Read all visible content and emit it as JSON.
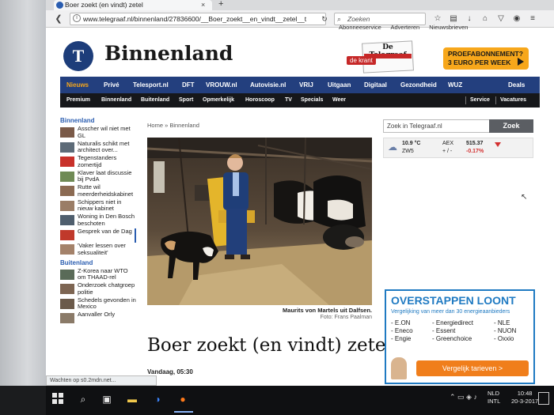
{
  "browser": {
    "tab_title": "Boer zoekt (en vindt) zetel",
    "tab_close": "×",
    "new_tab": "+",
    "url": "www.telegraaf.nl/binnenland/27836600/__Boer_zoekt__en_vindt__zetel__t",
    "search_placeholder": "Zoeken",
    "status_text": "Wachten op s0.2mdn.net..."
  },
  "header": {
    "top_links": [
      "Abonneeservice",
      "Adverteren",
      "Nieuwsbrieven"
    ],
    "logo_letter": "T",
    "section_title": "Binnenland",
    "paper_masthead": "De Telegraaf",
    "paper_label": "de krant",
    "promo_line1": "PROEFABONNEMENT?",
    "promo_line2": "3 EURO PER WEEK"
  },
  "main_nav": [
    "Nieuws",
    "Privé",
    "Telesport.nl",
    "DFT",
    "VROUW.nl",
    "Autovisie.nl",
    "VRIJ",
    "Uitgaan",
    "Digitaal",
    "Gezondheid",
    "WUZ",
    "Deals"
  ],
  "sub_nav": [
    "Premium",
    "Binnenland",
    "Buitenland",
    "Sport",
    "Opmerkelijk",
    "Horoscoop",
    "TV",
    "Specials",
    "Weer"
  ],
  "sub_nav_right": [
    "Service",
    "Vacatures"
  ],
  "sidebar": {
    "section1": "Binnenland",
    "items1": [
      "Asscher wil niet met GL",
      "Naturalis schikt met architect over...",
      "Tegenstanders zomertijd",
      "Klaver laat discussie bij PvdA",
      "Rutte wil meerderheidskabinet",
      "Schippers niet in nieuw kabinet",
      "Woning in Den Bosch beschoten",
      "Gesprek van de Dag",
      "'Vaker lessen over seksualiteit'"
    ],
    "section2": "Buitenland",
    "items2": [
      "Z-Korea naar WTO om THAAD-rel",
      "Onderzoek chatgroep politie",
      "Schedels gevonden in Mexico",
      "Aanvaller Orly"
    ]
  },
  "article": {
    "breadcrumb": "Home » Binnenland",
    "caption": "Maurits von Martels uit Dalfsen.",
    "credit": "Foto: Frans Paalman",
    "headline": "Boer zoekt (en vindt) zetel",
    "dateline": "Vandaag, 05:30"
  },
  "right": {
    "search_placeholder": "Zoek in Telegraaf.nl",
    "search_button": "Zoek",
    "weather_temp": "10.9 °C",
    "weather_wind": "ZW5",
    "aex_label": "AEX",
    "aex_value": "515.37",
    "aex_delta_label": "+ / -",
    "aex_delta": "-0.17%"
  },
  "ad": {
    "title": "OVERSTAPPEN LOONT",
    "subtitle": "Vergelijking van meer dan 30 energieaanbieders",
    "col1": [
      "- E.ON",
      "- Eneco",
      "- Engie"
    ],
    "col2": [
      "- Energiedirect",
      "- Essent",
      "- Greenchoice"
    ],
    "col3": [
      "- NLE",
      "- NUON",
      "- Oxxio"
    ],
    "button": "Vergelijk tarieven >"
  },
  "taskbar": {
    "lang1": "NLD",
    "lang2": "INTL",
    "time": "10:48",
    "date": "20-3-2017"
  },
  "colors": {
    "nav_blue": "#233f7e",
    "promo_orange": "#f7a71b",
    "link_blue": "#2a5db0",
    "ad_blue": "#1f7ac2"
  }
}
